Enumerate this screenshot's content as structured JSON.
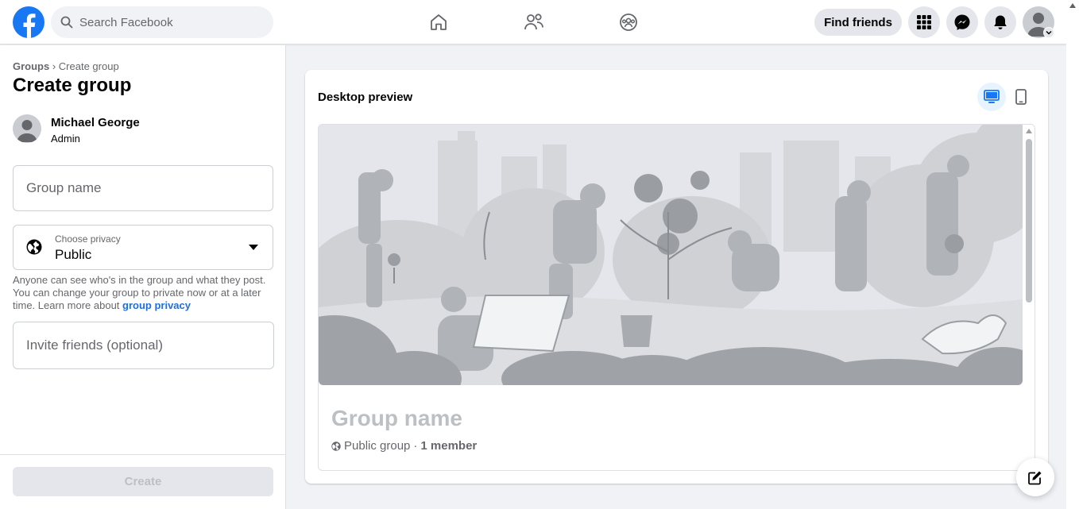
{
  "topbar": {
    "search_placeholder": "Search Facebook",
    "find_friends_label": "Find friends",
    "brand_color": "#1877f2"
  },
  "left_panel": {
    "breadcrumb_root": "Groups",
    "breadcrumb_sep": " › ",
    "breadcrumb_current": "Create group",
    "title": "Create group",
    "admin_name": "Michael George",
    "admin_role": "Admin",
    "group_name_placeholder": "Group name",
    "privacy_label": "Choose privacy",
    "privacy_value": "Public",
    "privacy_help_text": "Anyone can see who's in the group and what they post. You can change your group to private now or at a later time. Learn more about ",
    "privacy_help_link": "group privacy",
    "invite_placeholder": "Invite friends (optional)",
    "create_label": "Create"
  },
  "preview": {
    "title": "Desktop preview",
    "group_name": "Group name",
    "privacy_text": "Public group",
    "separator": "·",
    "member_count": "1 member",
    "active_view": "desktop"
  }
}
